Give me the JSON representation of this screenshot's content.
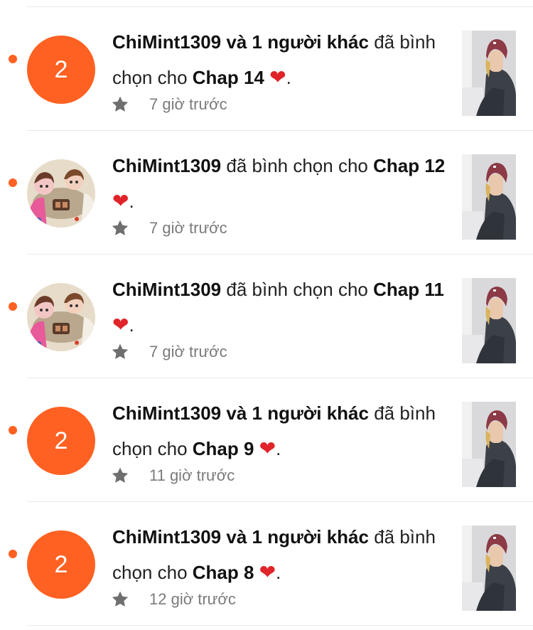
{
  "colors": {
    "accent": "#ff6122",
    "heart": "#e0242a",
    "meta_text": "#7a7a7a"
  },
  "icons": {
    "star": "star-icon",
    "heart": "heart-icon",
    "unread": "unread-dot-icon"
  },
  "notifications": [
    {
      "avatar_count": "2",
      "actor": "ChiMint1309 và 1 người khác",
      "action": " đã bình chọn cho ",
      "target": "Chap 14",
      "heart": "❤",
      "end": ".",
      "time": "7 giờ trước"
    },
    {
      "avatar_count": "",
      "actor": "ChiMint1309",
      "action": " đã bình chọn cho ",
      "target": "Chap 12",
      "heart": "❤",
      "end": ".",
      "time": "7 giờ trước"
    },
    {
      "avatar_count": "",
      "actor": "ChiMint1309",
      "action": " đã bình chọn cho ",
      "target": "Chap 11",
      "heart": "❤",
      "end": ".",
      "time": "7 giờ trước"
    },
    {
      "avatar_count": "2",
      "actor": "ChiMint1309 và 1 người khác",
      "action": " đã bình chọn cho ",
      "target": "Chap 9",
      "heart": "❤",
      "end": ".",
      "time": "11 giờ trước"
    },
    {
      "avatar_count": "2",
      "actor": "ChiMint1309 và 1 người khác",
      "action": " đã bình chọn cho ",
      "target": "Chap 8",
      "heart": "❤",
      "end": ".",
      "time": "12 giờ trước"
    }
  ]
}
